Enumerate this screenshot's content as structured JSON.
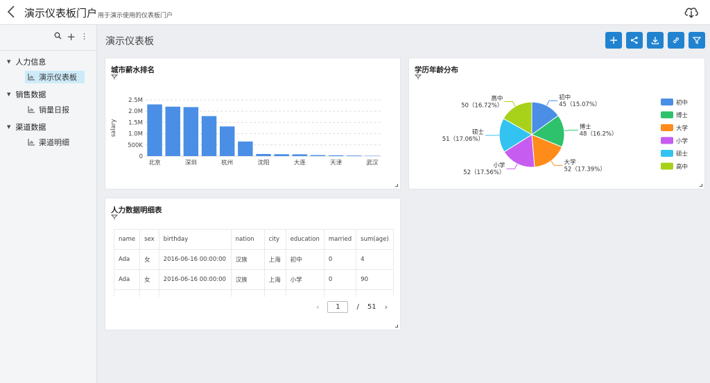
{
  "header": {
    "title": "演示仪表板门户",
    "subtitle": "用于演示使用的仪表板门户"
  },
  "sidebar": {
    "groups": [
      {
        "label": "人力信息",
        "items": [
          {
            "label": "演示仪表板",
            "active": true
          }
        ]
      },
      {
        "label": "销售数据",
        "items": [
          {
            "label": "销量日报",
            "active": false
          }
        ]
      },
      {
        "label": "渠道数据",
        "items": [
          {
            "label": "渠道明细",
            "active": false
          }
        ]
      }
    ]
  },
  "main": {
    "title": "演示仪表板",
    "toolbar": [
      "add-icon",
      "share-icon",
      "download-icon",
      "link-icon",
      "filter-icon"
    ]
  },
  "colors": {
    "accent": "#2183d0",
    "bar": "#4a8ee6",
    "active_bg": "#cdeaf8"
  },
  "chart_data": [
    {
      "type": "bar",
      "title": "城市薪水排名",
      "ylabel": "salary",
      "ylim": [
        0,
        2500000
      ],
      "yticks": [
        "0",
        "500K",
        "1.0M",
        "1.5M",
        "2.0M",
        "2.5M"
      ],
      "categories": [
        "北京",
        "",
        "深圳",
        "",
        "杭州",
        "",
        "沈阳",
        "",
        "大连",
        "",
        "天津",
        "",
        "武汉"
      ],
      "values": [
        2300000,
        2200000,
        2180000,
        1780000,
        1320000,
        650000,
        95000,
        85000,
        80000,
        45000,
        35000,
        25000,
        15000
      ]
    },
    {
      "type": "pie",
      "title": "学历年龄分布",
      "legend_position": "right",
      "slices": [
        {
          "name": "初中",
          "value": 45,
          "pct": "15.07%",
          "color": "#4a8ee6"
        },
        {
          "name": "博士",
          "value": 48,
          "pct": "16.2%",
          "color": "#2dc26b"
        },
        {
          "name": "大学",
          "value": 52,
          "pct": "17.39%",
          "color": "#ff8c1a"
        },
        {
          "name": "小学",
          "value": 52,
          "pct": "17.56%",
          "color": "#c65cf0"
        },
        {
          "name": "硕士",
          "value": 51,
          "pct": "17.06%",
          "color": "#33c3f0"
        },
        {
          "name": "高中",
          "value": 50,
          "pct": "16.72%",
          "color": "#a8d11a"
        }
      ]
    }
  ],
  "table_card": {
    "title": "人力数据明细表",
    "columns": [
      "name",
      "sex",
      "birthday",
      "nation",
      "city",
      "education",
      "married",
      "sum(age)"
    ],
    "rows": [
      [
        "Ada",
        "女",
        "2016-06-16 00:00:00",
        "汉族",
        "上海",
        "初中",
        "0",
        "4"
      ],
      [
        "Ada",
        "女",
        "2016-06-16 00:00:00",
        "汉族",
        "上海",
        "小学",
        "0",
        "90"
      ]
    ],
    "pager": {
      "current": "1",
      "total": "51",
      "separator": "/"
    }
  }
}
